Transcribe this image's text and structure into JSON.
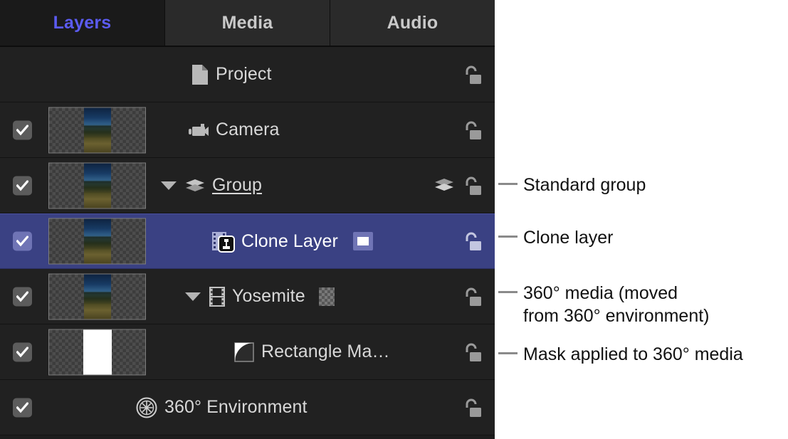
{
  "tabs": [
    {
      "label": "Layers",
      "active": true
    },
    {
      "label": "Media",
      "active": false
    },
    {
      "label": "Audio",
      "active": false
    }
  ],
  "colors": {
    "panel_background": "#1d1d1d",
    "row_background": "#212121",
    "selection_blue": "#3a4183",
    "active_tab_text": "#5b5bf0",
    "label_text": "#d8d8d8",
    "callout_text": "#111111",
    "leader_line": "#8a8a8a"
  },
  "rows": [
    {
      "name": "Project",
      "icon": "document-icon",
      "checkbox": false,
      "checked": false,
      "thumbnail": "none",
      "disclosure": "none",
      "selected": false,
      "lock": "unlocked-padlock-icon",
      "badge": "none",
      "group_layers_icon": false,
      "underline": false,
      "indent": 268
    },
    {
      "name": "Camera",
      "icon": "camera-icon",
      "checkbox": true,
      "checked": true,
      "thumbnail": "image",
      "disclosure": "none",
      "selected": false,
      "lock": "unlocked-padlock-icon",
      "badge": "none",
      "group_layers_icon": false,
      "underline": false,
      "indent": 262
    },
    {
      "name": "Group",
      "icon": "layers-stack-icon",
      "checkbox": true,
      "checked": true,
      "thumbnail": "image",
      "disclosure": "expanded",
      "selected": false,
      "lock": "unlocked-padlock-icon",
      "badge": "none",
      "group_layers_icon": true,
      "underline": true,
      "indent": 226
    },
    {
      "name": "Clone Layer",
      "icon": "clone-layer-icon",
      "checkbox": true,
      "checked": true,
      "thumbnail": "image",
      "disclosure": "none",
      "selected": true,
      "lock": "unlocked-padlock-icon",
      "badge": "rect-badge",
      "group_layers_icon": false,
      "underline": false,
      "indent": 296
    },
    {
      "name": "Yosemite",
      "icon": "film-strip-icon",
      "checkbox": true,
      "checked": true,
      "thumbnail": "image",
      "disclosure": "expanded",
      "selected": false,
      "lock": "unlocked-padlock-icon",
      "badge": "checker-badge",
      "group_layers_icon": false,
      "underline": false,
      "indent": 260
    },
    {
      "name": "Rectangle Ma…",
      "icon": "mask-shape-icon",
      "checkbox": true,
      "checked": true,
      "thumbnail": "mask",
      "disclosure": "none",
      "selected": false,
      "lock": "unlocked-padlock-icon",
      "badge": "none",
      "group_layers_icon": false,
      "underline": false,
      "indent": 328
    },
    {
      "name": "360° Environment",
      "icon": "globe-360-icon",
      "checkbox": true,
      "checked": true,
      "thumbnail": "none",
      "disclosure": "none",
      "selected": false,
      "lock": "unlocked-padlock-icon",
      "badge": "none",
      "group_layers_icon": false,
      "underline": false,
      "indent": 190
    }
  ],
  "callouts": [
    {
      "text": "Standard group",
      "target_row": "Group"
    },
    {
      "text": "Clone layer",
      "target_row": "Clone Layer"
    },
    {
      "text": "360° media (moved\nfrom 360° environment)",
      "target_row": "Yosemite"
    },
    {
      "text": "Mask applied to 360° media",
      "target_row": "Rectangle Ma…"
    }
  ]
}
